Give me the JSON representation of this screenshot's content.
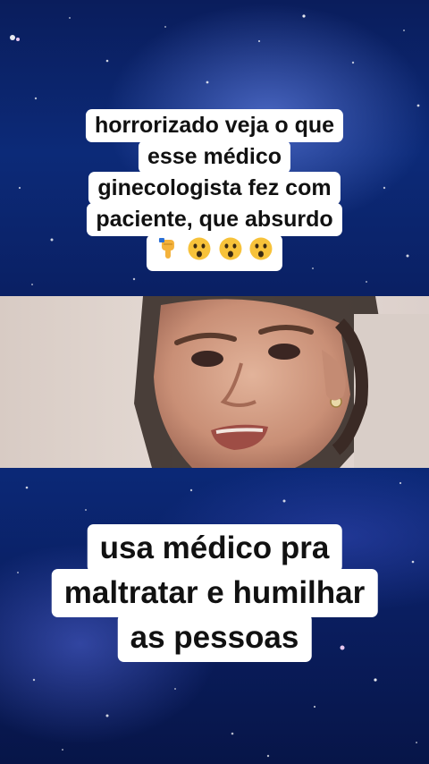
{
  "top_caption": {
    "lines": [
      "horrorizado veja o que",
      "esse médico",
      "ginecologista fez com",
      "paciente, que absurdo"
    ],
    "emojis": [
      "pointing-down-emoji",
      "astonished-face-emoji",
      "astonished-face-emoji",
      "astonished-face-emoji"
    ]
  },
  "bottom_caption": {
    "lines": [
      "usa médico pra",
      "maltratar e humilhar",
      "as pessoas"
    ]
  },
  "colors": {
    "background_top": "#0a1d5c",
    "background_bottom": "#071548",
    "caption_bg": "#ffffff",
    "caption_text": "#111111"
  }
}
